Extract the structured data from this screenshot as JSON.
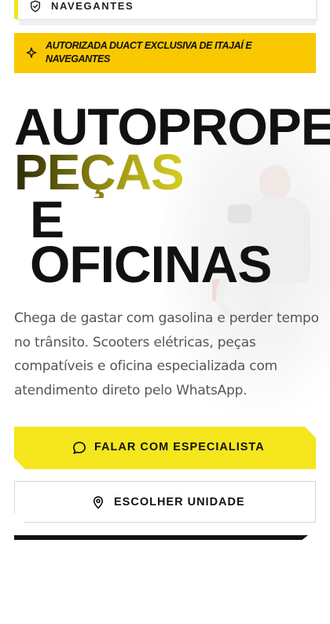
{
  "top_card": {
    "label": "NAVEGANTES",
    "icon": "shield-check-icon"
  },
  "notice": {
    "text": "AUTORIZADA DUACT EXCLUSIVA DE ITAJAÍ E NAVEGANTES",
    "icon": "sparkle-icon"
  },
  "hero": {
    "line1": "AUTOPROPE",
    "line2": "PEÇAS",
    "line3": "E",
    "line4": "OFICINAS",
    "description": "Chega de gastar com gasolina e perder tempo no trânsito. Scooters elétricas, peças compatíveis e oficina especializada com atendimento direto pelo WhatsApp."
  },
  "cta": {
    "primary_label": "FALAR COM ESPECIALISTA",
    "primary_icon": "chat-bubble-icon",
    "secondary_label": "ESCOLHER UNIDADE",
    "secondary_icon": "map-pin-icon"
  },
  "colors": {
    "accent_yellow": "#f5e61e",
    "notice_yellow": "#f9c800",
    "text_dark": "#111111",
    "text_body": "#555555"
  }
}
